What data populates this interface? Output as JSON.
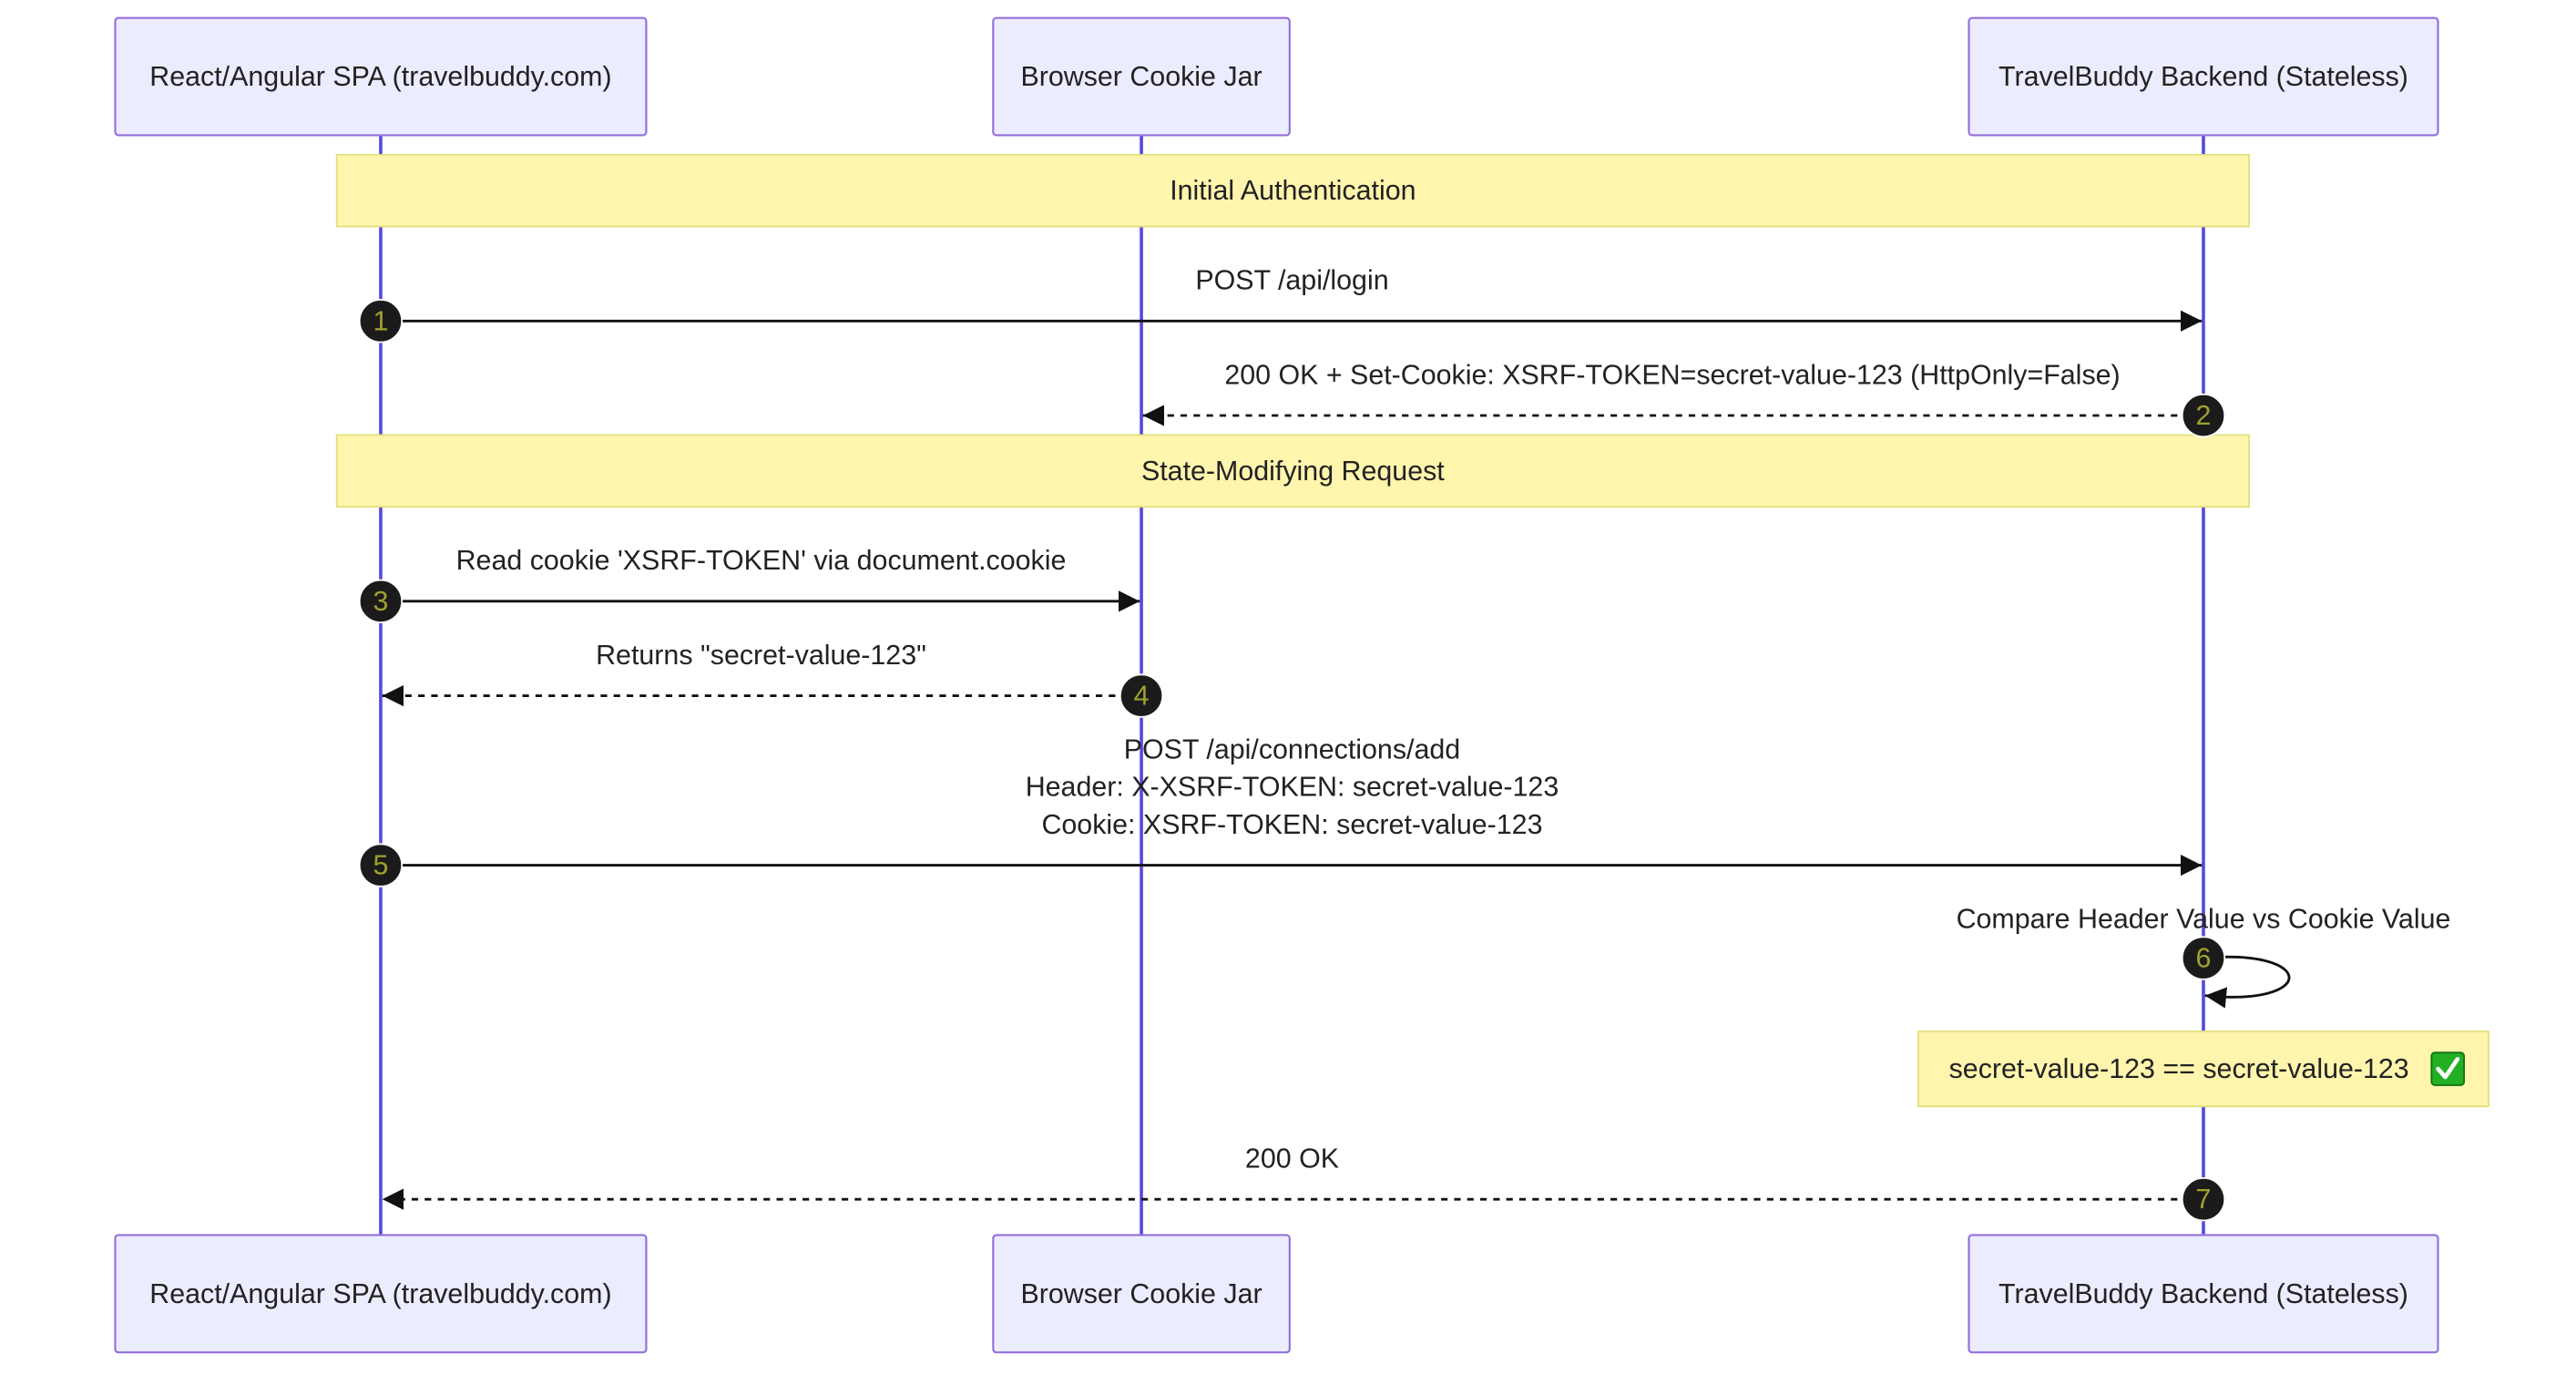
{
  "participants": [
    {
      "id": "spa",
      "label": "React/Angular SPA (travelbuddy.com)"
    },
    {
      "id": "jar",
      "label": "Browser Cookie Jar"
    },
    {
      "id": "backend",
      "label": "TravelBuddy Backend (Stateless)"
    }
  ],
  "sections": [
    {
      "label": "Initial Authentication"
    },
    {
      "label": "State-Modifying Request"
    }
  ],
  "messages": [
    {
      "number": "1",
      "from": "spa",
      "to": "backend",
      "style": "solid",
      "lines": [
        "POST /api/login"
      ]
    },
    {
      "number": "2",
      "from": "backend",
      "to": "jar",
      "style": "dashed",
      "lines": [
        "200 OK + Set-Cookie: XSRF-TOKEN=secret-value-123 (HttpOnly=False)"
      ]
    },
    {
      "number": "3",
      "from": "spa",
      "to": "jar",
      "style": "solid",
      "lines": [
        "Read cookie 'XSRF-TOKEN' via document.cookie"
      ]
    },
    {
      "number": "4",
      "from": "jar",
      "to": "spa",
      "style": "dashed",
      "lines": [
        "Returns \"secret-value-123\""
      ]
    },
    {
      "number": "5",
      "from": "spa",
      "to": "backend",
      "style": "solid",
      "lines": [
        "POST /api/connections/add",
        "Header: X-XSRF-TOKEN: secret-value-123",
        "Cookie: XSRF-TOKEN: secret-value-123"
      ]
    },
    {
      "number": "6",
      "from": "backend",
      "to": "backend",
      "style": "solid",
      "lines": [
        "Compare Header Value vs Cookie Value"
      ]
    },
    {
      "number": "7",
      "from": "backend",
      "to": "spa",
      "style": "dashed",
      "lines": [
        "200 OK"
      ]
    }
  ],
  "notes": [
    {
      "text": "secret-value-123 == secret-value-123",
      "icon": "check-mark-icon"
    }
  ],
  "colors": {
    "actor_fill": "#ECECFF",
    "actor_border": "#9370DB",
    "lifeline": "#5548E0",
    "note_fill": "#FFF5AD",
    "note_border": "#E2E07A",
    "arrow": "#111111",
    "badge_fill": "#1B1B1B",
    "badge_text": "#A0A030",
    "check_fill": "#22B022"
  }
}
